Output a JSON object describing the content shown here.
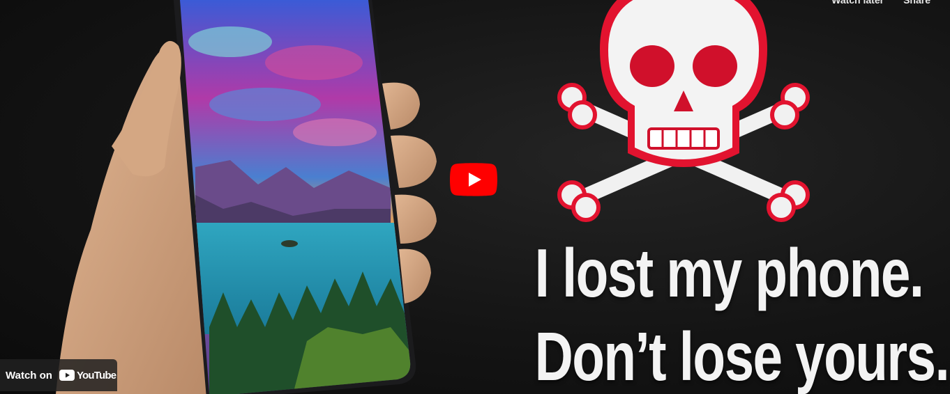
{
  "top_actions": {
    "watch_later": "Watch later",
    "share": "Share"
  },
  "thumbnail": {
    "headline_line1": "I lost my phone.",
    "headline_line2": "Don’t lose yours."
  },
  "watch_on": {
    "label": "Watch on",
    "brand": "YouTube"
  },
  "colors": {
    "play_red": "#ff0000",
    "skull_red": "#e2132f",
    "background": "#151515"
  },
  "icons": {
    "play": "play-icon",
    "skull": "skull-crossbones-icon",
    "youtube": "youtube-logo-icon"
  }
}
